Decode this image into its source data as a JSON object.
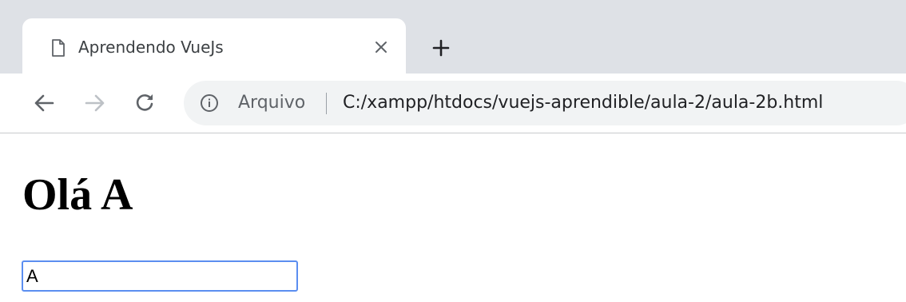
{
  "tab": {
    "title": "Aprendendo VueJs",
    "page_icon": "page-icon",
    "close_icon": "close-icon"
  },
  "new_tab": {
    "icon": "plus-icon"
  },
  "toolbar": {
    "back_icon": "back-arrow-icon",
    "forward_icon": "forward-arrow-icon",
    "reload_icon": "reload-icon"
  },
  "omnibox": {
    "info_icon": "info-icon",
    "security_label": "Arquivo",
    "url": "C:/xampp/htdocs/vuejs-aprendible/aula-2/aula-2b.html"
  },
  "page": {
    "heading": "Olá A",
    "input_value": "A"
  },
  "colors": {
    "tabstrip": "#dee1e6",
    "omnibox_bg": "#f1f3f4",
    "input_focus_border": "#5b8ef0"
  }
}
